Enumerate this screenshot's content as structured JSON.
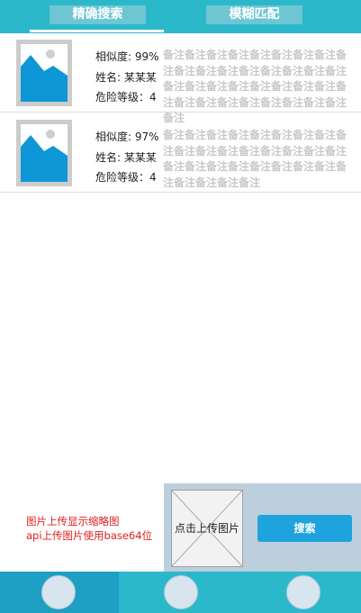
{
  "tabs": [
    {
      "label": "精确搜索",
      "active": true
    },
    {
      "label": "模糊匹配",
      "active": false
    }
  ],
  "results": [
    {
      "similarity": "相似度: 99%",
      "name": "姓名: 某某某",
      "danger_level": "危险等级：4",
      "remark": "备注备注备注备注备注备注备注备注备注备注备注备注备注备注备注备注备注备注备注备注备注备注备注备注备注备注备注备注备注备注备注备注备注备注备注"
    },
    {
      "similarity": "相似度: 97%",
      "name": "姓名: 某某某",
      "danger_level": "危险等级：4",
      "remark": "备注备注备注备注备注备注备注备注备注备注备注备注备注备注备注备注备注备注备注备注备注备注备注备注备注备注备注备注备注备注"
    }
  ],
  "note": {
    "line1": "图片上传显示缩略图",
    "line2": "api上传图片使用base64位"
  },
  "upload": {
    "label": "点击上传图片",
    "search_label": "搜索"
  },
  "colors": {
    "header": "#2bb8cb",
    "tab_bg": "#6ec6d3",
    "accent_blue": "#1fa3de",
    "note_red": "#e02020",
    "remark_gray": "#c8c8c8"
  },
  "icons": {
    "thumbnail": "image-placeholder-icon",
    "upload": "x-placeholder-icon",
    "nav": "circle-icon"
  }
}
